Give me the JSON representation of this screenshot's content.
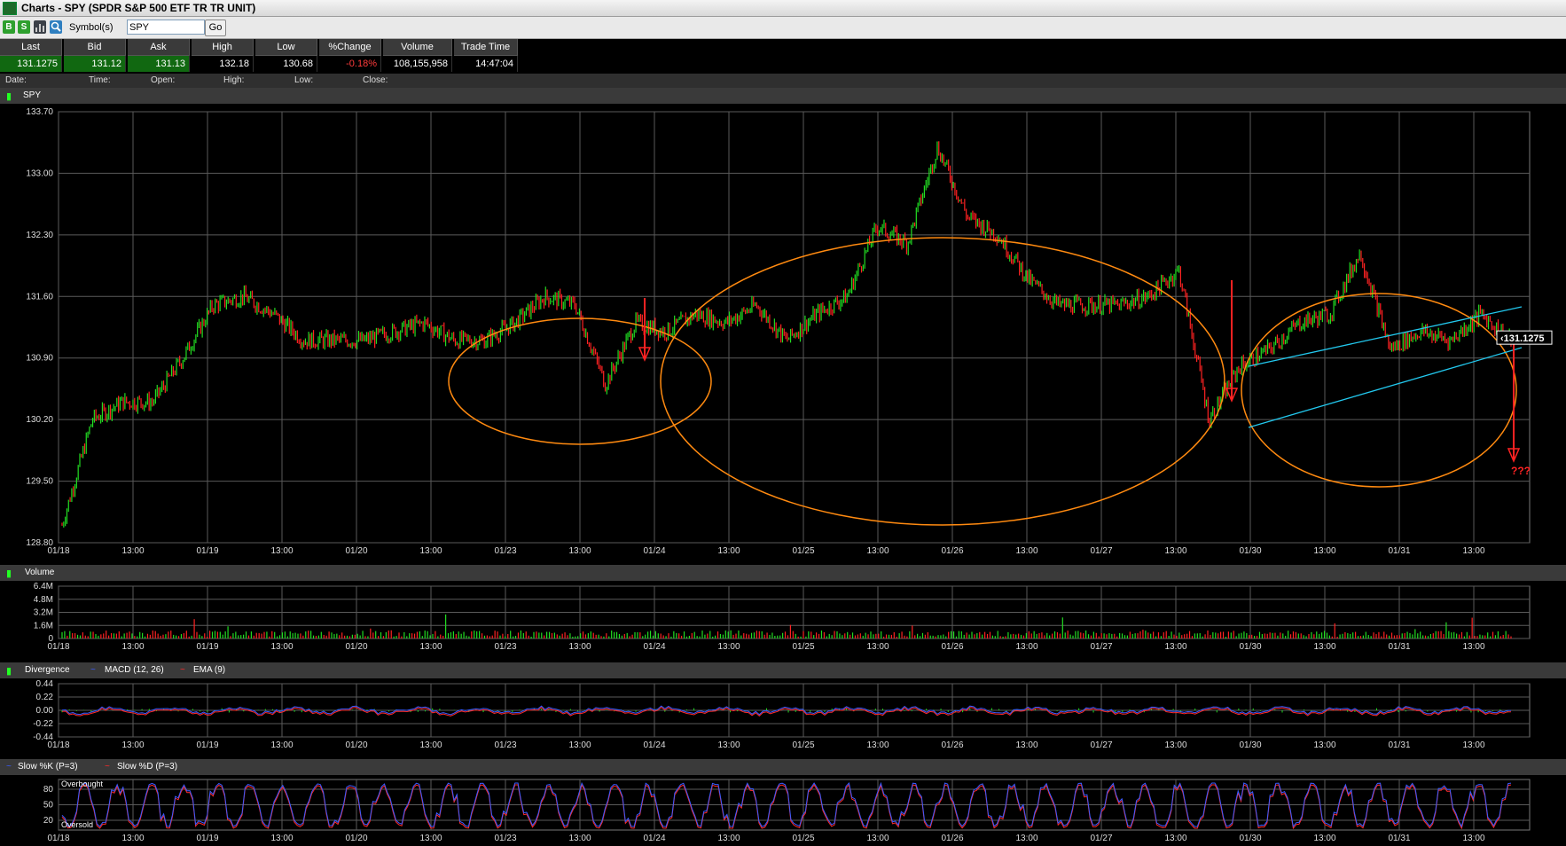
{
  "window": {
    "title": "Charts - SPY (SPDR S&P 500 ETF TR TR UNIT)"
  },
  "toolbar": {
    "symbol_label": "Symbol(s)",
    "symbol_value": "SPY",
    "go_label": "Go",
    "buy_label": "B",
    "sell_label": "S"
  },
  "quote": {
    "headers": [
      "Last",
      "Bid",
      "Ask",
      "High",
      "Low",
      "%Change",
      "Volume",
      "Trade Time"
    ],
    "values": [
      "131.1275",
      "131.12",
      "131.13",
      "132.18",
      "130.68",
      "-0.18%",
      "108,155,958",
      "14:47:04"
    ]
  },
  "info_labels": [
    "Date:",
    "Time:",
    "Open:",
    "High:",
    "Low:",
    "Close:"
  ],
  "price_panel": {
    "label": "SPY",
    "y_ticks": [
      "133.70",
      "133.00",
      "132.30",
      "131.60",
      "130.90",
      "130.20",
      "129.50",
      "128.80"
    ],
    "last_price_tag": "131.1275",
    "annotation": "???"
  },
  "x_axis_labels": [
    "01/18",
    "13:00",
    "01/19",
    "13:00",
    "01/20",
    "13:00",
    "01/23",
    "13:00",
    "01/24",
    "13:00",
    "01/25",
    "13:00",
    "01/26",
    "13:00",
    "01/27",
    "13:00",
    "01/30",
    "13:00",
    "01/31",
    "13:00"
  ],
  "volume_panel": {
    "label": "Volume",
    "y_ticks": [
      "6.4M",
      "4.8M",
      "3.2M",
      "1.6M",
      "0"
    ]
  },
  "macd_panel": {
    "labels": [
      "Divergence",
      "MACD (12, 26)",
      "EMA (9)"
    ],
    "y_ticks": [
      "0.44",
      "0.22",
      "0.00",
      "-0.22",
      "-0.44"
    ]
  },
  "stoch_panel": {
    "labels": [
      "Slow %K (P=3)",
      "Slow %D (P=3)"
    ],
    "y_ticks": [
      "80",
      "50",
      "20"
    ],
    "overbought_label": "Overbought",
    "oversold_label": "Oversold"
  },
  "colors": {
    "up": "#22dd22",
    "down": "#ff2222",
    "ellipse": "#ff8a10",
    "channel": "#22c8ee",
    "macd": "#3a5bff",
    "ema": "#ff2a2a"
  },
  "chart_data": {
    "type": "line",
    "title": "SPY",
    "ylim": [
      128.8,
      133.7
    ],
    "x": [
      "01/18 09:30",
      "01/18 13:00",
      "01/19 09:30",
      "01/19 13:00",
      "01/20 09:30",
      "01/20 13:00",
      "01/23 09:30",
      "01/23 13:00",
      "01/24 09:30",
      "01/24 13:00",
      "01/25 09:30",
      "01/25 13:00",
      "01/26 09:30",
      "01/26 13:00",
      "01/27 09:30",
      "01/27 13:00",
      "01/30 09:30",
      "01/30 13:00",
      "01/31 09:30",
      "01/31 13:00",
      "01/31 14:47"
    ],
    "series": [
      {
        "values": [
          129.0,
          130.2,
          130.4,
          130.4,
          130.9,
          131.5,
          131.6,
          131.4,
          131.1,
          131.1,
          131.1,
          131.2,
          131.3,
          131.1,
          131.1,
          131.3,
          131.6,
          131.5,
          130.6,
          131.3,
          131.2,
          131.4,
          131.3,
          131.5,
          131.1,
          131.4,
          131.6,
          132.4,
          132.2,
          133.3,
          132.5,
          132.3,
          131.8,
          131.5,
          131.5,
          131.5,
          131.6,
          131.9,
          130.2,
          130.8,
          131.0,
          131.3,
          131.4,
          132.1,
          131.0,
          131.2,
          131.1,
          131.4,
          131.1
        ]
      }
    ]
  }
}
